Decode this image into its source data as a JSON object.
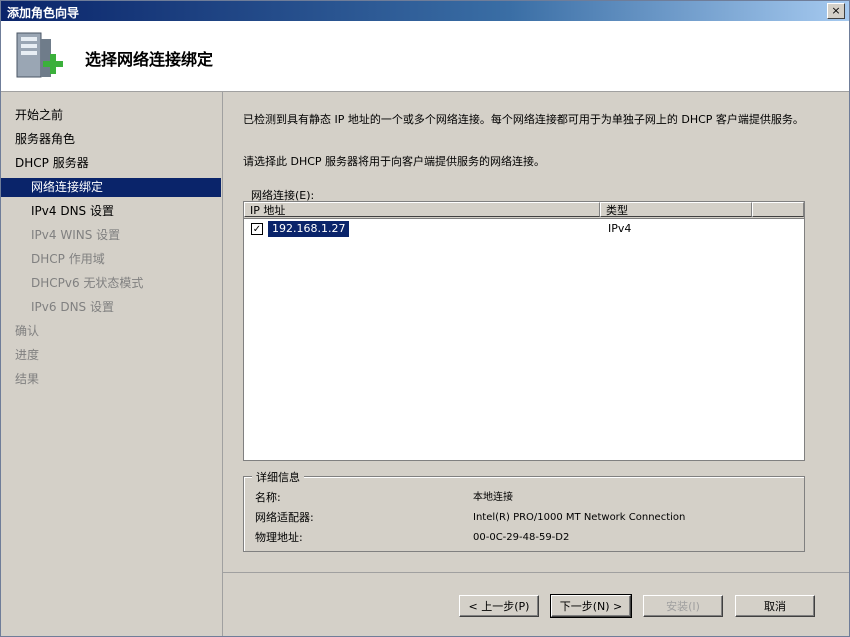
{
  "window": {
    "title": "添加角色向导",
    "close_label": "×"
  },
  "header": {
    "title": "选择网络连接绑定"
  },
  "sidebar": {
    "items": [
      {
        "label": "开始之前",
        "state": "normal",
        "sub": false
      },
      {
        "label": "服务器角色",
        "state": "normal",
        "sub": false
      },
      {
        "label": "DHCP 服务器",
        "state": "normal",
        "sub": false
      },
      {
        "label": "网络连接绑定",
        "state": "active",
        "sub": true
      },
      {
        "label": "IPv4 DNS 设置",
        "state": "normal",
        "sub": true
      },
      {
        "label": "IPv4 WINS 设置",
        "state": "disabled",
        "sub": true
      },
      {
        "label": "DHCP 作用域",
        "state": "disabled",
        "sub": true
      },
      {
        "label": "DHCPv6 无状态模式",
        "state": "disabled",
        "sub": true
      },
      {
        "label": "IPv6 DNS 设置",
        "state": "disabled",
        "sub": true
      },
      {
        "label": "确认",
        "state": "disabled",
        "sub": false
      },
      {
        "label": "进度",
        "state": "disabled",
        "sub": false
      },
      {
        "label": "结果",
        "state": "disabled",
        "sub": false
      }
    ]
  },
  "main": {
    "description": "已检测到具有静态 IP 地址的一个或多个网络连接。每个网络连接都可用于为单独子网上的 DHCP 客户端提供服务。",
    "instruction": "请选择此 DHCP 服务器将用于向客户端提供服务的网络连接。",
    "list_label": "网络连接(E):",
    "columns": [
      "IP 地址",
      "类型"
    ],
    "rows": [
      {
        "checked": true,
        "ip": "192.168.1.27",
        "type": "IPv4"
      }
    ],
    "checkmark": "✓"
  },
  "details": {
    "legend": "详细信息",
    "fields": [
      {
        "label": "名称:",
        "value": "本地连接"
      },
      {
        "label": "网络适配器:",
        "value": "Intel(R) PRO/1000 MT Network Connection"
      },
      {
        "label": "物理地址:",
        "value": "00-0C-29-48-59-D2"
      }
    ]
  },
  "footer": {
    "prev_label": "< 上一步(P)",
    "next_label": "下一步(N) >",
    "install_label": "安装(I)",
    "cancel_label": "取消"
  }
}
